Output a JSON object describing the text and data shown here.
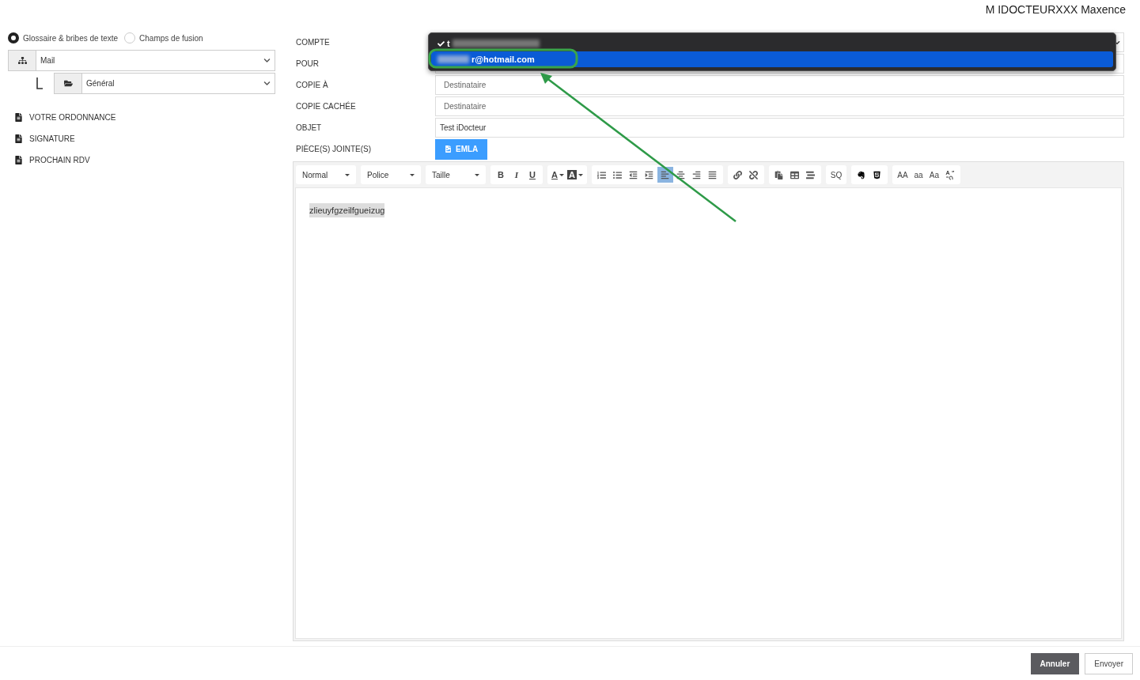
{
  "header": {
    "user": "M IDOCTEURXXX Maxence"
  },
  "sidebar": {
    "modes": [
      {
        "label": "Glossaire & bribes de texte",
        "selected": true
      },
      {
        "label": "Champs de fusion",
        "selected": false
      }
    ],
    "selects": [
      {
        "kind": "category",
        "value": "Mail"
      },
      {
        "kind": "folder",
        "value": "Général"
      }
    ],
    "snippets": [
      "VOTRE ORDONNANCE",
      "SIGNATURE",
      "PROCHAIN RDV"
    ]
  },
  "form": {
    "fields": [
      {
        "kind": "select",
        "label": "COMPTE"
      },
      {
        "kind": "tags",
        "label": "POUR"
      },
      {
        "kind": "input",
        "label": "COPIE À",
        "placeholder": "Destinataire"
      },
      {
        "kind": "input",
        "label": "COPIE CACHÉE",
        "placeholder": "Destinataire"
      },
      {
        "kind": "input",
        "label": "OBJET",
        "value": "Test iDocteur"
      },
      {
        "kind": "attachment",
        "label": "PIÈCE(S) JOINTE(S)",
        "value": "EMLA"
      }
    ],
    "account_menu": [
      {
        "text": "t",
        "checked": true,
        "selected": false
      },
      {
        "text": "r@hotmail.com",
        "checked": false,
        "selected": true
      }
    ]
  },
  "toolbar": [
    [
      {
        "kind": "select",
        "label": "Normal"
      }
    ],
    [
      {
        "kind": "select",
        "label": "Police"
      }
    ],
    [
      {
        "kind": "select",
        "label": "Taille"
      }
    ],
    [
      {
        "kind": "bold",
        "label": "B"
      },
      {
        "kind": "italic",
        "label": "I"
      },
      {
        "kind": "underline",
        "label": "U"
      }
    ],
    [
      {
        "kind": "color",
        "label": "A"
      },
      {
        "kind": "background",
        "label": "A"
      }
    ],
    [
      {
        "kind": "ordered-list"
      },
      {
        "kind": "bullet-list"
      },
      {
        "kind": "outdent"
      },
      {
        "kind": "indent"
      },
      {
        "kind": "align-left",
        "selected": true
      },
      {
        "kind": "align-center",
        "selected": false
      },
      {
        "kind": "align-right",
        "selected": false
      },
      {
        "kind": "align-justify",
        "selected": false
      }
    ],
    [
      {
        "kind": "link"
      },
      {
        "kind": "unlink"
      }
    ],
    [
      {
        "kind": "paste"
      },
      {
        "kind": "table"
      },
      {
        "kind": "insert-list"
      }
    ],
    [
      {
        "kind": "text",
        "label": "SQ"
      }
    ],
    [
      {
        "kind": "note"
      },
      {
        "kind": "html"
      }
    ],
    [
      {
        "kind": "text",
        "label": "AA"
      },
      {
        "kind": "text",
        "label": "aa"
      },
      {
        "kind": "text",
        "label": "Aa"
      },
      {
        "kind": "case-swap"
      }
    ]
  ],
  "editor": {
    "text": "zlieuyfgzeilfgueizug",
    "selected": true
  },
  "footer": {
    "buttons": [
      {
        "kind": "primary",
        "label": "Annuler"
      },
      {
        "kind": "secondary",
        "label": "Envoyer"
      }
    ]
  }
}
